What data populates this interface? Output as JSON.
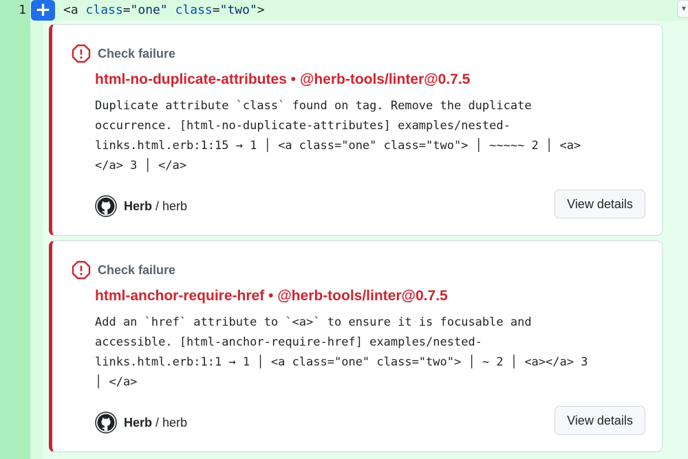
{
  "code": {
    "line_number": "1",
    "add_button": "+",
    "code_parts": {
      "tag_open": "<a ",
      "attr1": "class",
      "eq1": "=",
      "val1": "\"one\"",
      "space": " ",
      "attr2": "class",
      "eq2": "=",
      "val2": "\"two\"",
      "tag_close": ">"
    }
  },
  "annotations": [
    {
      "status": "Check failure",
      "rule_title": "html-no-duplicate-attributes • @herb-tools/linter@0.7.5",
      "message": "Duplicate attribute `class` found on tag. Remove the duplicate\noccurrence. [html-no-duplicate-attributes] examples/nested-\nlinks.html.erb:1:15 → 1 │ <a class=\"one\" class=\"two\"> │ ~~~~~ 2 │ <a>\n</a> 3 │ </a>",
      "owner": "Herb",
      "separator": "/",
      "repo": "herb",
      "button": "View details"
    },
    {
      "status": "Check failure",
      "rule_title": "html-anchor-require-href • @herb-tools/linter@0.7.5",
      "message": "Add an `href` attribute to `<a>` to ensure it is focusable and\naccessible. [html-anchor-require-href] examples/nested-\nlinks.html.erb:1:1 → 1 │ <a class=\"one\" class=\"two\"> │ ~ 2 │ <a></a> 3\n│ </a>",
      "owner": "Herb",
      "separator": "/",
      "repo": "herb",
      "button": "View details"
    }
  ],
  "colors": {
    "failure": "#d1242f",
    "added_line": "#dafbe1",
    "add_button": "#1f6feb"
  },
  "icons": {
    "status_icon": "octagon-alert-icon",
    "app_icon": "github-mark-icon"
  }
}
